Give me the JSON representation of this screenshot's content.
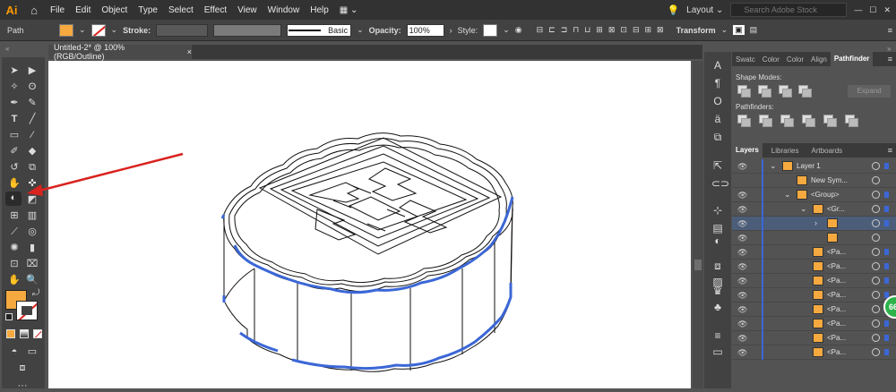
{
  "app": {
    "logo": "Ai"
  },
  "menu": [
    "File",
    "Edit",
    "Object",
    "Type",
    "Select",
    "Effect",
    "View",
    "Window",
    "Help"
  ],
  "workspace": {
    "label": "Layout",
    "search_placeholder": "Search Adobe Stock"
  },
  "control": {
    "selection": "Path",
    "stroke_label": "Stroke:",
    "brush": "Basic",
    "opacity_label": "Opacity:",
    "opacity_value": "100%",
    "style_label": "Style:",
    "transform": "Transform",
    "fill_color": "#f5a93f"
  },
  "document": {
    "tab_title": "Untitled-2* @ 100% (RGB/Outline)",
    "close": "×"
  },
  "pathfinder": {
    "tabs": [
      "Swatc",
      "Color",
      "Color",
      "Align",
      "Pathfinder"
    ],
    "shape_modes": "Shape Modes:",
    "pathfinders": "Pathfinders:",
    "expand": "Expand"
  },
  "layers": {
    "tabs": [
      "Layers",
      "Libraries",
      "Artboards"
    ],
    "rows": [
      {
        "name": "Layer 1"
      },
      {
        "name": "New Sym..."
      },
      {
        "name": "<Group>"
      },
      {
        "name": "<Gr..."
      },
      {
        "name": ""
      },
      {
        "name": ""
      },
      {
        "name": "<Pa..."
      },
      {
        "name": "<Pa..."
      },
      {
        "name": "<Pa..."
      },
      {
        "name": "<Pa..."
      },
      {
        "name": "<Pa..."
      },
      {
        "name": "<Pa..."
      },
      {
        "name": "<Pa..."
      },
      {
        "name": "<Pa..."
      }
    ]
  },
  "badge": "66",
  "colors": {
    "accent": "#f5a93f",
    "selection": "#3b67d6",
    "arrow": "#d9231f"
  }
}
